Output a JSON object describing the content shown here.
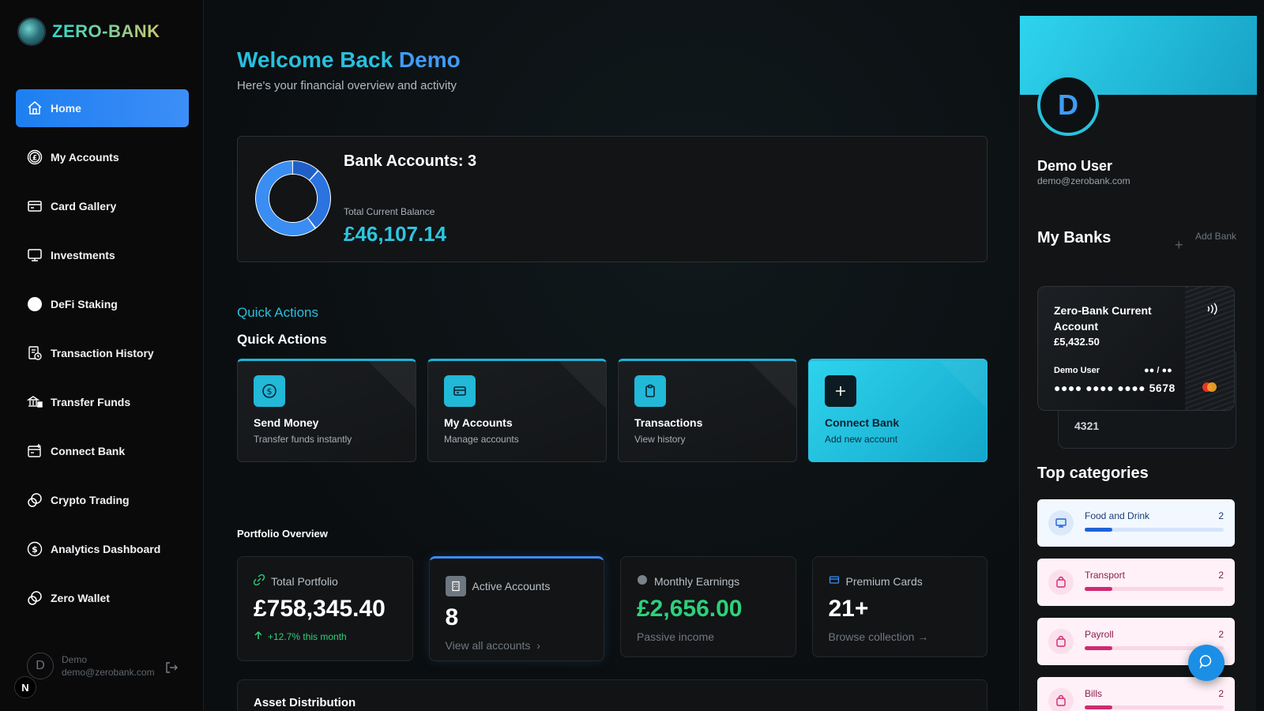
{
  "app": {
    "name": "ZERO-BANK"
  },
  "sidebar": {
    "items": [
      {
        "label": "Home",
        "icon": "home-icon",
        "active": true
      },
      {
        "label": "My Accounts",
        "icon": "pound-coin-icon"
      },
      {
        "label": "Card Gallery",
        "icon": "credit-card-icon"
      },
      {
        "label": "Investments",
        "icon": "monitor-icon"
      },
      {
        "label": "DeFi Staking",
        "icon": "circle-icon"
      },
      {
        "label": "Transaction History",
        "icon": "history-icon"
      },
      {
        "label": "Transfer Funds",
        "icon": "bank-transfer-icon"
      },
      {
        "label": "Connect Bank",
        "icon": "connect-icon"
      },
      {
        "label": "Crypto Trading",
        "icon": "crypto-icon"
      },
      {
        "label": "Analytics Dashboard",
        "icon": "dollar-circle-icon"
      },
      {
        "label": "Zero Wallet",
        "icon": "wallet-icon"
      }
    ],
    "user": {
      "initial": "D",
      "name": "Demo",
      "email": "demo@zerobank.com"
    },
    "badge": "N"
  },
  "main": {
    "welcome_prefix": "Welcome Back",
    "welcome_name": "Demo",
    "subtitle": "Here's your financial overview and activity",
    "balance": {
      "bank_accounts_label": "Bank Accounts: 3",
      "total_label": "Total Current Balance",
      "total_value": "£46,107.14",
      "segments": [
        0.12,
        0.28,
        0.6
      ],
      "segment_colors": [
        "#1f5fc7",
        "#2a73e0",
        "#3a8df2"
      ]
    },
    "quick_actions_heading": "Quick Actions",
    "quick_actions_title": "Quick Actions",
    "quick_actions": [
      {
        "label": "Send Money",
        "sub": "Transfer funds instantly",
        "icon": "dollar-icon"
      },
      {
        "label": "My Accounts",
        "sub": "Manage accounts",
        "icon": "card-icon"
      },
      {
        "label": "Transactions",
        "sub": "View history",
        "icon": "clipboard-icon"
      },
      {
        "label": "Connect Bank",
        "sub": "Add new account",
        "icon": "plus-icon"
      }
    ],
    "portfolio_title": "Portfolio Overview",
    "portfolio": {
      "total": {
        "label": "Total Portfolio",
        "value": "£758,345.40",
        "foot": "+12.7% this month"
      },
      "active": {
        "label": "Active Accounts",
        "value": "8",
        "foot": "View all accounts"
      },
      "earnings": {
        "label": "Monthly Earnings",
        "value": "£2,656.00",
        "foot": "Passive income"
      },
      "premium": {
        "label": "Premium Cards",
        "value": "21+",
        "foot": "Browse collection →"
      }
    },
    "asset_title": "Asset Distribution"
  },
  "profile": {
    "initial": "D",
    "name": "Demo User",
    "email": "demo@zerobank.com",
    "my_banks_title": "My Banks",
    "add_bank_label": "Add Bank",
    "card": {
      "name": "Zero-Bank Current Account",
      "balance": "£5,432.50",
      "holder": "Demo User",
      "expiry": "●● / ●●",
      "number": "●●●● ●●●● ●●●● 5678",
      "back_number": "4321"
    },
    "top_categories_title": "Top categories",
    "categories": [
      {
        "label": "Food and Drink",
        "count": "2",
        "fill": 0.2,
        "theme": "blue",
        "icon": "monitor-icon"
      },
      {
        "label": "Transport",
        "count": "2",
        "fill": 0.2,
        "theme": "pink",
        "icon": "bag-icon"
      },
      {
        "label": "Payroll",
        "count": "2",
        "fill": 0.2,
        "theme": "pink",
        "icon": "bag-icon"
      },
      {
        "label": "Bills",
        "count": "2",
        "fill": 0.2,
        "theme": "pink",
        "icon": "bag-icon"
      }
    ]
  }
}
